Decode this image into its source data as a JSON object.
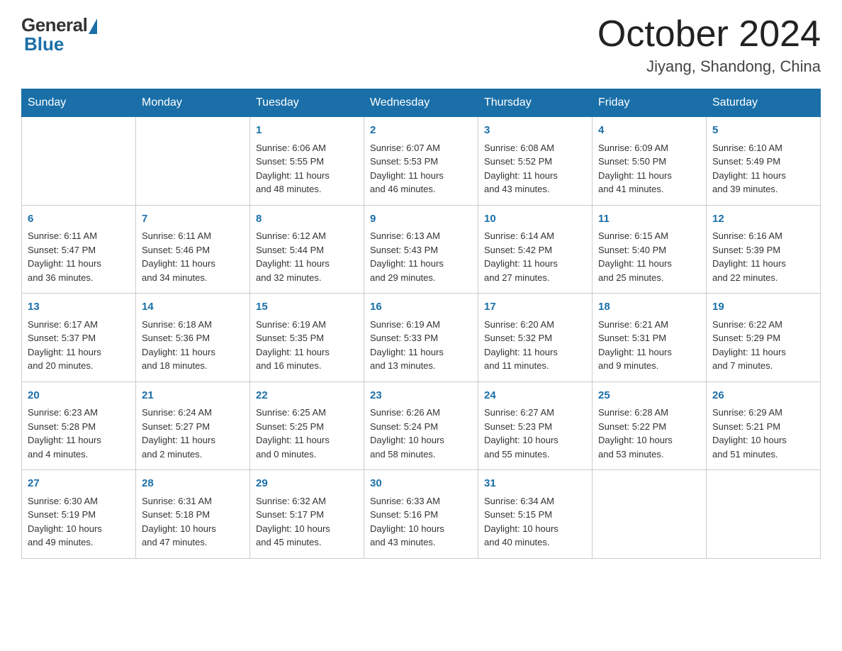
{
  "header": {
    "logo_general": "General",
    "logo_blue": "Blue",
    "month_title": "October 2024",
    "location": "Jiyang, Shandong, China"
  },
  "days_of_week": [
    "Sunday",
    "Monday",
    "Tuesday",
    "Wednesday",
    "Thursday",
    "Friday",
    "Saturday"
  ],
  "weeks": [
    [
      {
        "day": "",
        "detail": ""
      },
      {
        "day": "",
        "detail": ""
      },
      {
        "day": "1",
        "detail": "Sunrise: 6:06 AM\nSunset: 5:55 PM\nDaylight: 11 hours\nand 48 minutes."
      },
      {
        "day": "2",
        "detail": "Sunrise: 6:07 AM\nSunset: 5:53 PM\nDaylight: 11 hours\nand 46 minutes."
      },
      {
        "day": "3",
        "detail": "Sunrise: 6:08 AM\nSunset: 5:52 PM\nDaylight: 11 hours\nand 43 minutes."
      },
      {
        "day": "4",
        "detail": "Sunrise: 6:09 AM\nSunset: 5:50 PM\nDaylight: 11 hours\nand 41 minutes."
      },
      {
        "day": "5",
        "detail": "Sunrise: 6:10 AM\nSunset: 5:49 PM\nDaylight: 11 hours\nand 39 minutes."
      }
    ],
    [
      {
        "day": "6",
        "detail": "Sunrise: 6:11 AM\nSunset: 5:47 PM\nDaylight: 11 hours\nand 36 minutes."
      },
      {
        "day": "7",
        "detail": "Sunrise: 6:11 AM\nSunset: 5:46 PM\nDaylight: 11 hours\nand 34 minutes."
      },
      {
        "day": "8",
        "detail": "Sunrise: 6:12 AM\nSunset: 5:44 PM\nDaylight: 11 hours\nand 32 minutes."
      },
      {
        "day": "9",
        "detail": "Sunrise: 6:13 AM\nSunset: 5:43 PM\nDaylight: 11 hours\nand 29 minutes."
      },
      {
        "day": "10",
        "detail": "Sunrise: 6:14 AM\nSunset: 5:42 PM\nDaylight: 11 hours\nand 27 minutes."
      },
      {
        "day": "11",
        "detail": "Sunrise: 6:15 AM\nSunset: 5:40 PM\nDaylight: 11 hours\nand 25 minutes."
      },
      {
        "day": "12",
        "detail": "Sunrise: 6:16 AM\nSunset: 5:39 PM\nDaylight: 11 hours\nand 22 minutes."
      }
    ],
    [
      {
        "day": "13",
        "detail": "Sunrise: 6:17 AM\nSunset: 5:37 PM\nDaylight: 11 hours\nand 20 minutes."
      },
      {
        "day": "14",
        "detail": "Sunrise: 6:18 AM\nSunset: 5:36 PM\nDaylight: 11 hours\nand 18 minutes."
      },
      {
        "day": "15",
        "detail": "Sunrise: 6:19 AM\nSunset: 5:35 PM\nDaylight: 11 hours\nand 16 minutes."
      },
      {
        "day": "16",
        "detail": "Sunrise: 6:19 AM\nSunset: 5:33 PM\nDaylight: 11 hours\nand 13 minutes."
      },
      {
        "day": "17",
        "detail": "Sunrise: 6:20 AM\nSunset: 5:32 PM\nDaylight: 11 hours\nand 11 minutes."
      },
      {
        "day": "18",
        "detail": "Sunrise: 6:21 AM\nSunset: 5:31 PM\nDaylight: 11 hours\nand 9 minutes."
      },
      {
        "day": "19",
        "detail": "Sunrise: 6:22 AM\nSunset: 5:29 PM\nDaylight: 11 hours\nand 7 minutes."
      }
    ],
    [
      {
        "day": "20",
        "detail": "Sunrise: 6:23 AM\nSunset: 5:28 PM\nDaylight: 11 hours\nand 4 minutes."
      },
      {
        "day": "21",
        "detail": "Sunrise: 6:24 AM\nSunset: 5:27 PM\nDaylight: 11 hours\nand 2 minutes."
      },
      {
        "day": "22",
        "detail": "Sunrise: 6:25 AM\nSunset: 5:25 PM\nDaylight: 11 hours\nand 0 minutes."
      },
      {
        "day": "23",
        "detail": "Sunrise: 6:26 AM\nSunset: 5:24 PM\nDaylight: 10 hours\nand 58 minutes."
      },
      {
        "day": "24",
        "detail": "Sunrise: 6:27 AM\nSunset: 5:23 PM\nDaylight: 10 hours\nand 55 minutes."
      },
      {
        "day": "25",
        "detail": "Sunrise: 6:28 AM\nSunset: 5:22 PM\nDaylight: 10 hours\nand 53 minutes."
      },
      {
        "day": "26",
        "detail": "Sunrise: 6:29 AM\nSunset: 5:21 PM\nDaylight: 10 hours\nand 51 minutes."
      }
    ],
    [
      {
        "day": "27",
        "detail": "Sunrise: 6:30 AM\nSunset: 5:19 PM\nDaylight: 10 hours\nand 49 minutes."
      },
      {
        "day": "28",
        "detail": "Sunrise: 6:31 AM\nSunset: 5:18 PM\nDaylight: 10 hours\nand 47 minutes."
      },
      {
        "day": "29",
        "detail": "Sunrise: 6:32 AM\nSunset: 5:17 PM\nDaylight: 10 hours\nand 45 minutes."
      },
      {
        "day": "30",
        "detail": "Sunrise: 6:33 AM\nSunset: 5:16 PM\nDaylight: 10 hours\nand 43 minutes."
      },
      {
        "day": "31",
        "detail": "Sunrise: 6:34 AM\nSunset: 5:15 PM\nDaylight: 10 hours\nand 40 minutes."
      },
      {
        "day": "",
        "detail": ""
      },
      {
        "day": "",
        "detail": ""
      }
    ]
  ]
}
